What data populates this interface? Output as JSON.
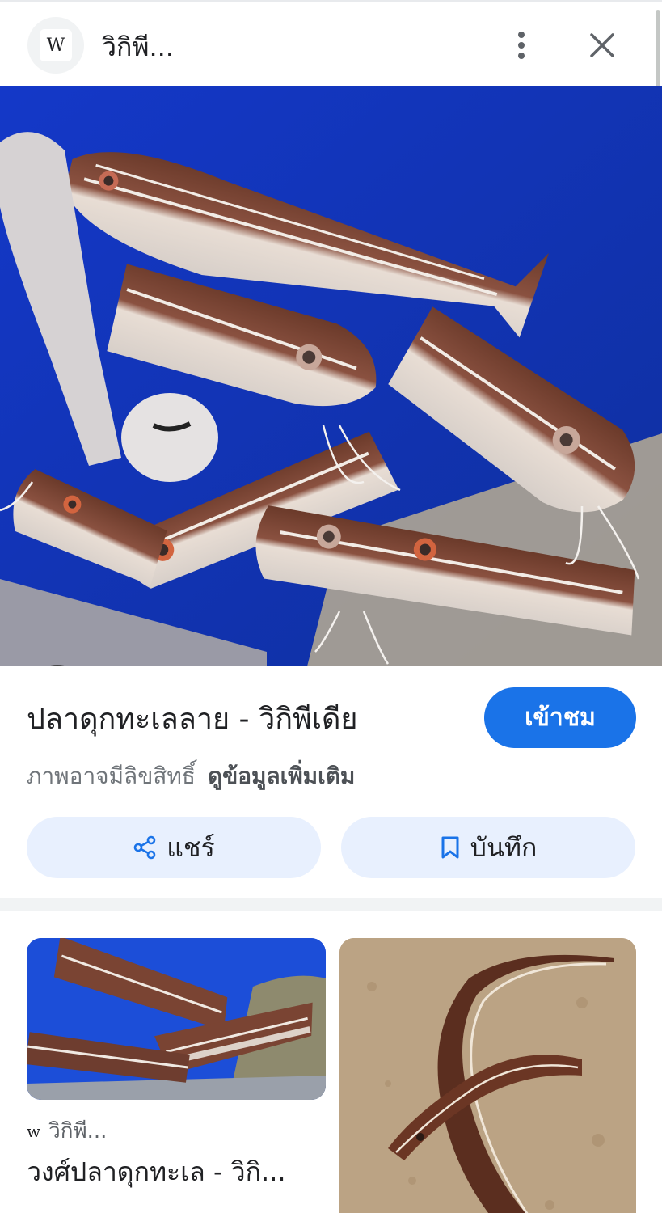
{
  "header": {
    "favicon_letter": "W",
    "site_name": "วิกิพี...",
    "more_icon": "more-vert-icon",
    "close_icon": "close-icon"
  },
  "main_image": {
    "description_icon": "fish-photo",
    "lens_icon": "google-lens-icon"
  },
  "result": {
    "title": "ปลาดุกทะเลลาย - วิกิพีเดีย",
    "visit_label": "เข้าชม",
    "copyright_text": "ภาพอาจมีลิขสิทธิ์",
    "more_info_link": "ดูข้อมูลเพิ่มเติม"
  },
  "actions": {
    "share_label": "แชร์",
    "share_icon": "share-icon",
    "save_label": "บันทึก",
    "save_icon": "bookmark-icon"
  },
  "related": [
    {
      "source_letter": "w",
      "source": "วิกิพี...",
      "title": "วงศ์ปลาดุกทะเล - วิกิ..."
    },
    {
      "source_letter": "",
      "source": "",
      "title": ""
    }
  ],
  "colors": {
    "accent": "#1a73e8",
    "action_bg": "#e8f0fe",
    "water": "#1639b8"
  }
}
